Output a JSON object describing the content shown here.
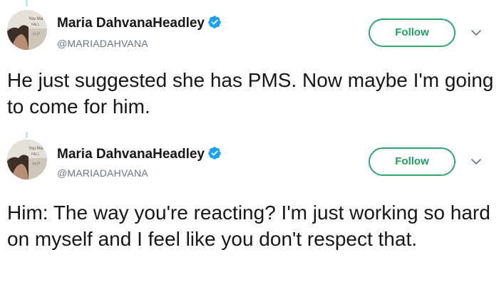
{
  "colors": {
    "follow_accent": "#1e9f5e",
    "verified_badge": "#1da1f2",
    "handle_text": "#657786",
    "thread_line": "#c6ead6"
  },
  "tweets": [
    {
      "author": {
        "display_name": "Maria DahvanaHeadley",
        "handle": "@MARIADAHVANA",
        "verified": true,
        "avatar": "avatar-icon"
      },
      "follow_label": "Follow",
      "menu_icon": "chevron-down-icon",
      "text": "He just suggested she has PMS. Now maybe I'm going to come for him."
    },
    {
      "author": {
        "display_name": "Maria DahvanaHeadley",
        "handle": "@MARIADAHVANA",
        "verified": true,
        "avatar": "avatar-icon"
      },
      "follow_label": "Follow",
      "menu_icon": "chevron-down-icon",
      "text": "Him: The way you're reacting? I'm just working so hard on myself and I feel like you don't respect that."
    }
  ]
}
